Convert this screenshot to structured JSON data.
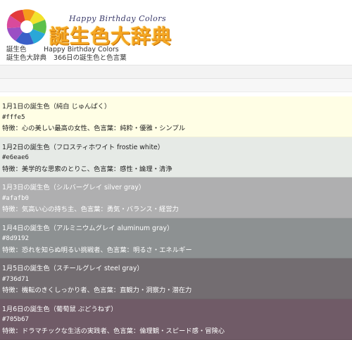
{
  "header": {
    "logo_en": "Happy Birthday Colors",
    "logo_jp": "誕生色大辞典",
    "desc": [
      {
        "key": "誕生色",
        "value": "Happy Birthday Colors"
      },
      {
        "key": "誕生色大辞典",
        "value": "366日の誕生色と色言葉"
      }
    ]
  },
  "entries": [
    {
      "title": "1月1日の誕生色（純白 じゅんぱく）",
      "code": "#fffe5",
      "traits": "特徴：心の美しい最高の女性、色言葉：純粋・優雅・シンプル",
      "bg": "#fffee5",
      "fg": "#222222"
    },
    {
      "title": "1月2日の誕生色（フロスティホワイト frostie white）",
      "code": "#e6eae6",
      "traits": "特徴：美学的な思索のとりこ、色言葉：感性・論理・清浄",
      "bg": "#e6eae6",
      "fg": "#222222"
    },
    {
      "title": "1月3日の誕生色（シルバーグレイ silver gray）",
      "code": "#afafb0",
      "traits": "特徴：気高い心の持ち主、色言葉：勇気・バランス・経営力",
      "bg": "#afafb0",
      "fg": "#ffffff"
    },
    {
      "title": "1月4日の誕生色（アルミニウムグレイ aluminum gray）",
      "code": "#8d9192",
      "traits": "特徴：恐れを知らぬ明るい挑戦者、色言葉：明るさ・エネルギー",
      "bg": "#8d9192",
      "fg": "#ffffff"
    },
    {
      "title": "1月5日の誕生色（スチールグレイ steel gray）",
      "code": "#736d71",
      "traits": "特徴：機転のきくしっかり者、色言葉：直観力・洞察力・潜在力",
      "bg": "#736d71",
      "fg": "#ffffff"
    },
    {
      "title": "1月6日の誕生色（葡萄鼠 ぶどうねず）",
      "code": "#705b67",
      "traits": "特徴：ドラマチックな生活の実践者、色言葉：倫理観・スピード感・冒険心",
      "bg": "#705b67",
      "fg": "#ffffff"
    }
  ]
}
